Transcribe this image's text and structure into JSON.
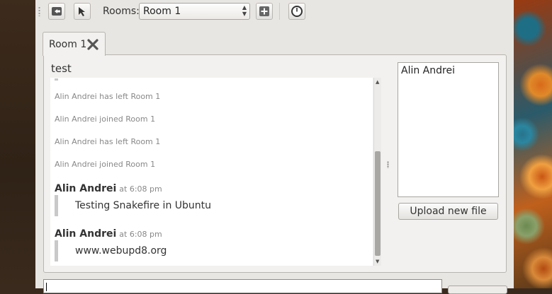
{
  "toolbar": {
    "rooms_label": "Rooms:",
    "rooms_selected": "Room 1",
    "icons": [
      "leave-room-icon",
      "cursor-select-icon",
      "add-room-icon",
      "away-clock-icon"
    ]
  },
  "tabs": [
    {
      "label": "Room 1"
    }
  ],
  "room": {
    "topic": "test",
    "events": [
      "Alin Andrei has left Room 1",
      "Alin Andrei joined Room 1",
      "Alin Andrei has left Room 1",
      "Alin Andrei joined Room 1"
    ],
    "messages": [
      {
        "author": "Alin Andrei",
        "time": "at 6:08 pm",
        "text": "Testing Snakefire in Ubuntu"
      },
      {
        "author": "Alin Andrei",
        "time": "at 6:08 pm",
        "text": "www.webupd8.org"
      }
    ],
    "users": [
      "Alin Andrei"
    ],
    "upload_label": "Upload new file"
  },
  "colors": {
    "window_bg": "#e8e6e3",
    "chat_bg": "#ffffff",
    "meta_text": "#888888"
  }
}
